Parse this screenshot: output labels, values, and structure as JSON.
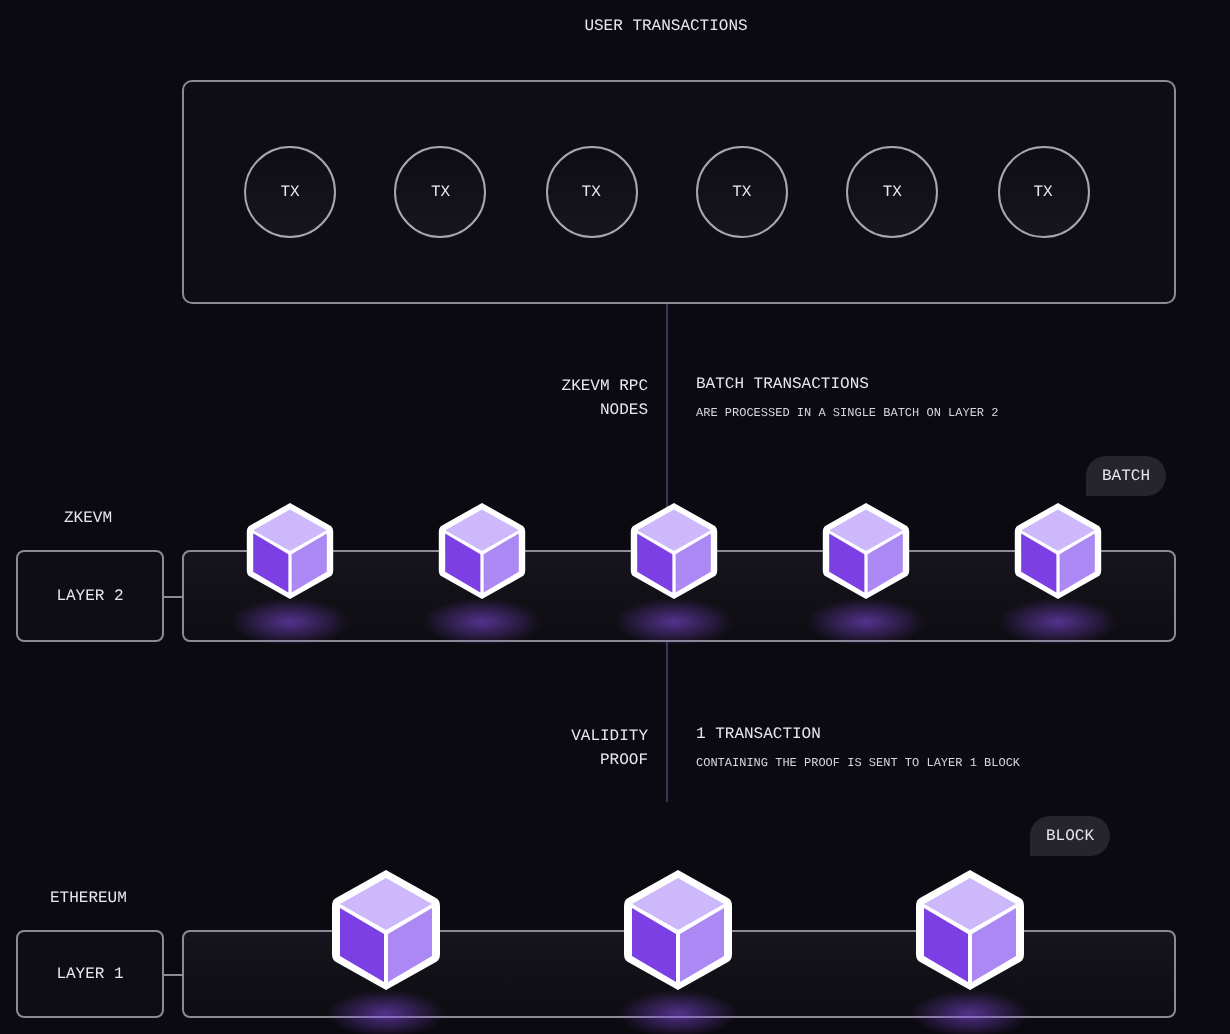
{
  "title": "USER TRANSACTIONS",
  "transactions": [
    {
      "label": "TX"
    },
    {
      "label": "TX"
    },
    {
      "label": "TX"
    },
    {
      "label": "TX"
    },
    {
      "label": "TX"
    },
    {
      "label": "TX"
    }
  ],
  "step_batch": {
    "side_label": "ZKEVM RPC NODES",
    "heading": "BATCH TRANSACTIONS",
    "detail": "ARE PROCESSED IN A SINGLE BATCH ON LAYER 2"
  },
  "layer2": {
    "caption": "ZKEVM",
    "label": "LAYER 2",
    "bubble": "BATCH",
    "cubes": [
      {
        "kind": "cube"
      },
      {
        "kind": "cube"
      },
      {
        "kind": "cube"
      },
      {
        "kind": "cube"
      },
      {
        "kind": "cube"
      }
    ]
  },
  "step_proof": {
    "side_label": "VALIDITY PROOF",
    "heading": "1 TRANSACTION",
    "detail": "CONTAINING THE PROOF IS SENT TO LAYER 1 BLOCK"
  },
  "layer1": {
    "caption": "ETHEREUM",
    "label": "LAYER 1",
    "bubble": "BLOCK",
    "cubes": [
      {
        "kind": "cube"
      },
      {
        "kind": "cube"
      },
      {
        "kind": "cube"
      }
    ]
  }
}
